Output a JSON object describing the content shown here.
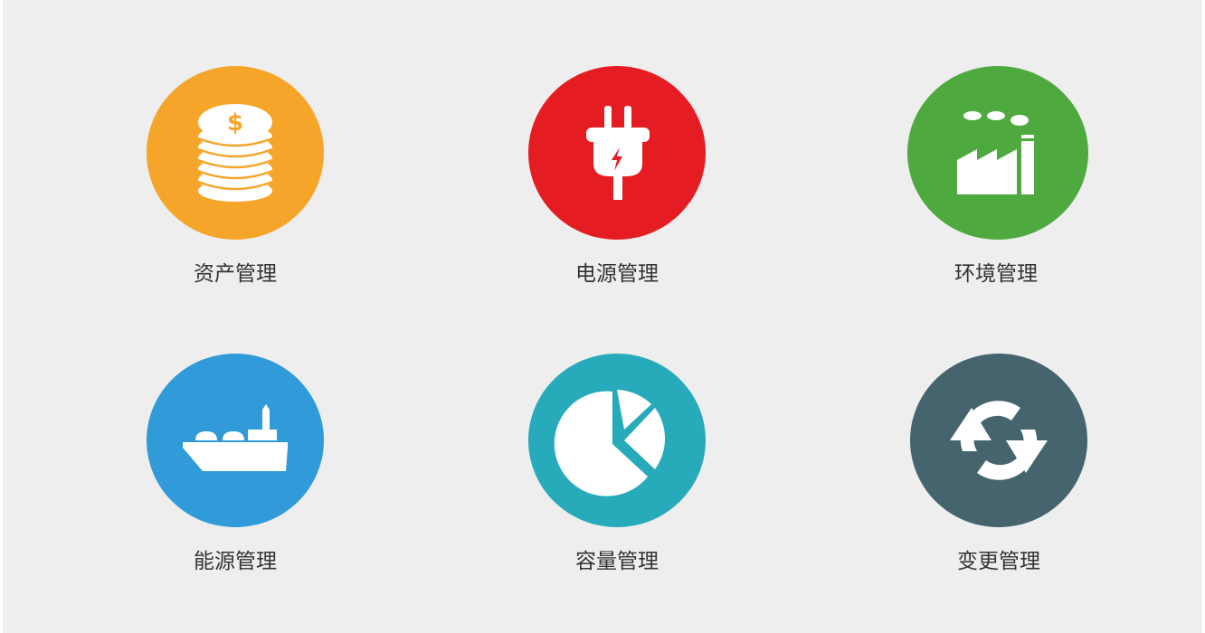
{
  "tiles": [
    {
      "label": "资产管理",
      "icon": "coins-icon",
      "color": "#F5A52A"
    },
    {
      "label": "电源管理",
      "icon": "plug-icon",
      "color": "#E61C23"
    },
    {
      "label": "环境管理",
      "icon": "factory-icon",
      "color": "#4EAA3F"
    },
    {
      "label": "能源管理",
      "icon": "ship-icon",
      "color": "#319BD9"
    },
    {
      "label": "容量管理",
      "icon": "pie-chart-icon",
      "color": "#27ABBA"
    },
    {
      "label": "变更管理",
      "icon": "refresh-icon",
      "color": "#46646E"
    }
  ]
}
